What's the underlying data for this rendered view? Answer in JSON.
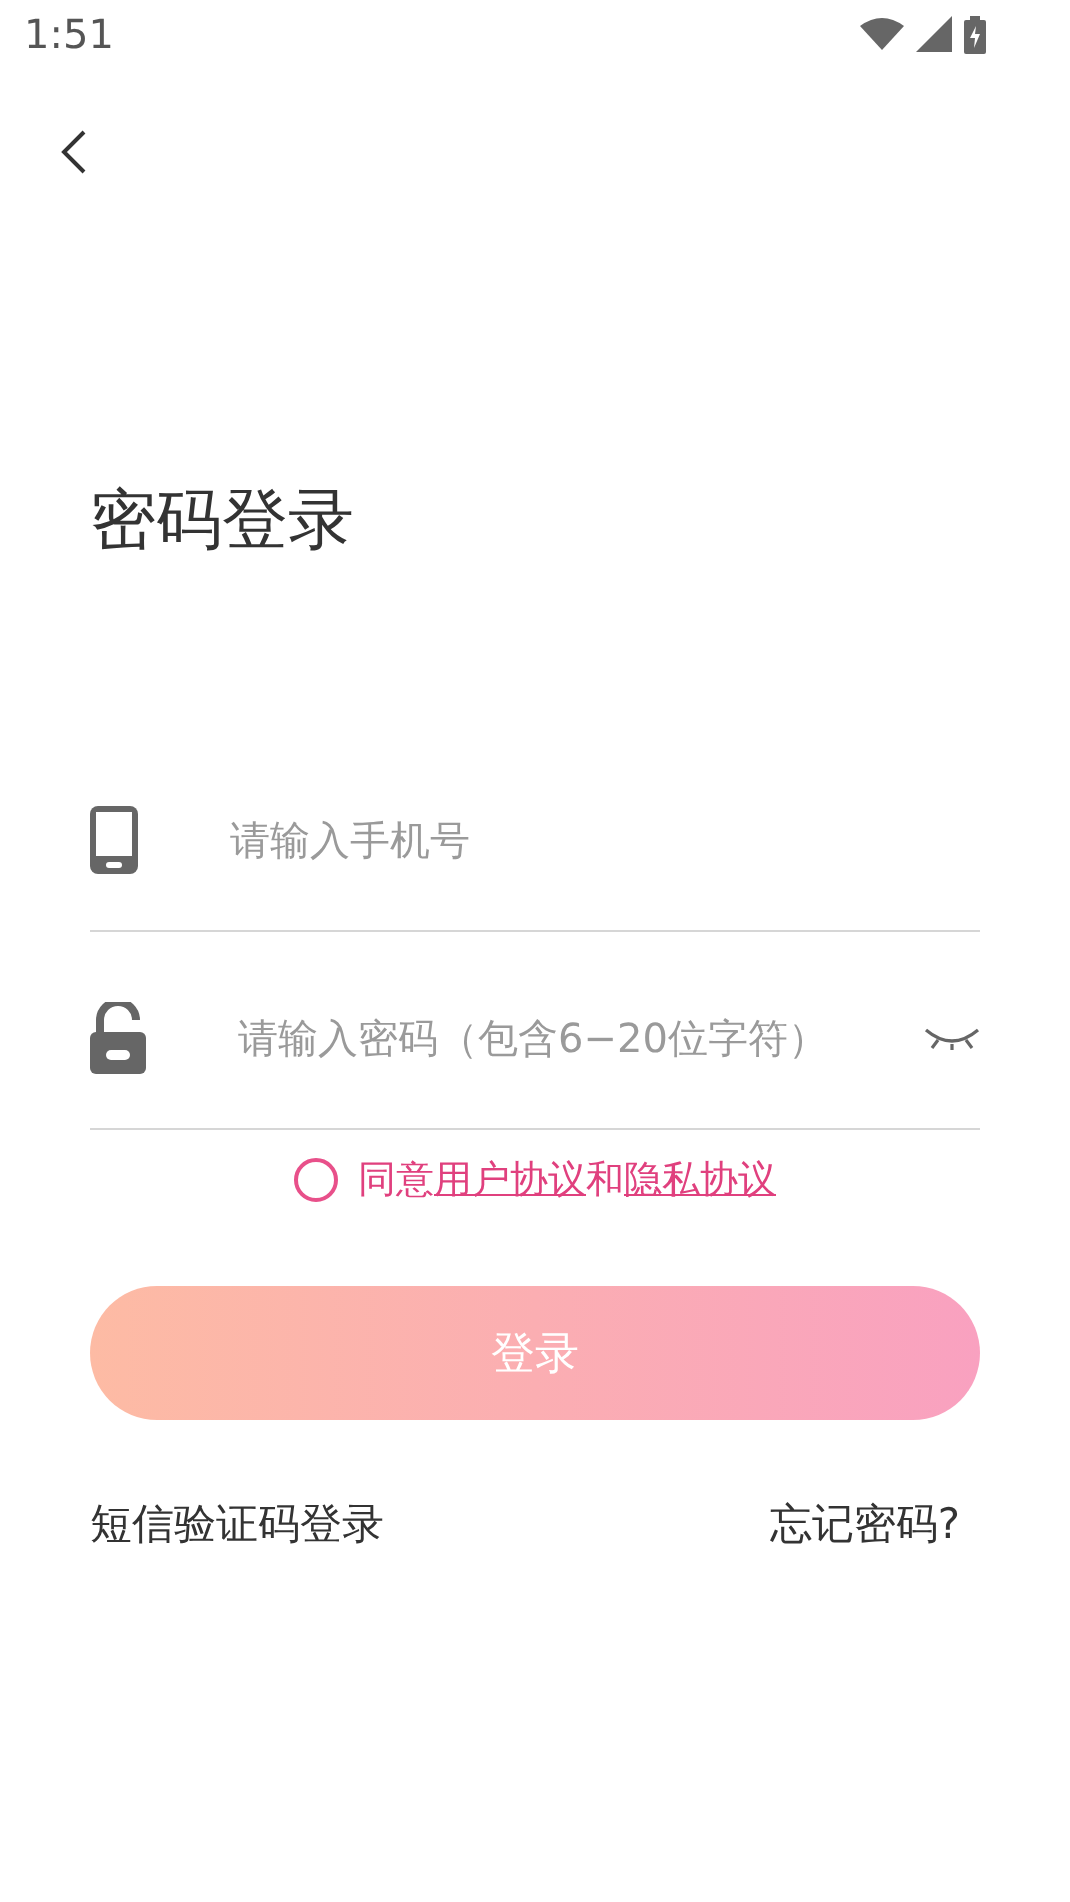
{
  "status_bar": {
    "time": "1:51"
  },
  "title": "密码登录",
  "phone_field": {
    "placeholder": "请输入手机号"
  },
  "password_field": {
    "placeholder": "请输入密码（包含6−20位字符）",
    "password_visible": false
  },
  "agreement": {
    "checked": false,
    "parts": [
      {
        "kind": "text",
        "text": "同意"
      },
      {
        "kind": "link",
        "text": "用户协议"
      },
      {
        "kind": "text",
        "text": "和"
      },
      {
        "kind": "link",
        "text": "隐私协议"
      }
    ]
  },
  "login_button": "登录",
  "sms_login_link": "短信验证码登录",
  "forgot_password_link": "忘记密码?"
}
